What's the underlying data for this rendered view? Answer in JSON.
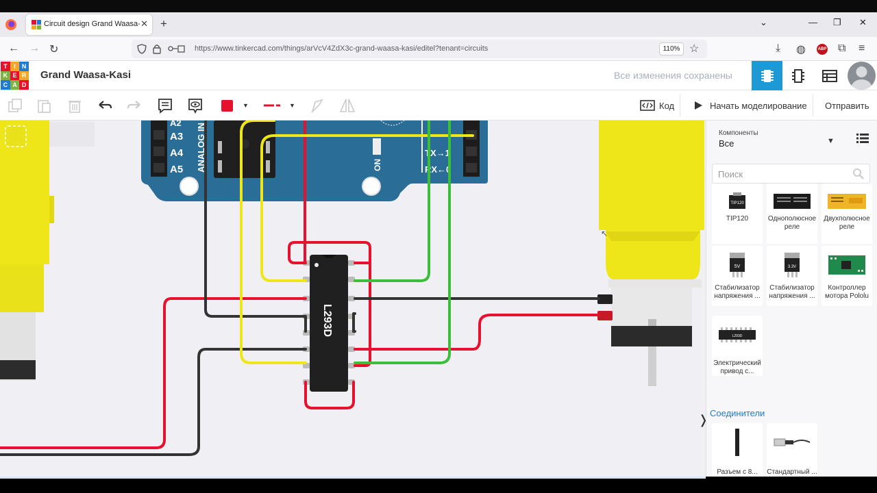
{
  "browser": {
    "tab_title": "Circuit design Grand Waasa-Kasi",
    "url": "https://www.tinkercad.com/things/arVcV4ZdX3c-grand-waasa-kasi/editel?tenant=circuits",
    "zoom": "110%"
  },
  "app": {
    "logo_letters": [
      "T",
      "I",
      "N",
      "K",
      "E",
      "R",
      "C",
      "A",
      "D"
    ],
    "project_title": "Grand Waasa-Kasi",
    "save_status": "Все изменения сохранены"
  },
  "toolbar": {
    "code_label": "Код",
    "simulate_label": "Начать моделирование",
    "send_label": "Отправить",
    "wire_color": "#e8112d"
  },
  "canvas": {
    "arduino_pins": [
      "A2",
      "A3",
      "A4",
      "A5"
    ],
    "analog_label": "ANALOG IN",
    "on_label": "ON",
    "tx_label": "TX→1",
    "rx_label": "RX←0",
    "chip_label": "L293D"
  },
  "sidebar": {
    "components_label": "Компоненты",
    "components_value": "Все",
    "search_placeholder": "Поиск",
    "cards": [
      {
        "label": "TIP120",
        "thumb_text": "TIP120"
      },
      {
        "label": "Однополюсное реле",
        "thumb_text": ""
      },
      {
        "label": "Двухполюсное реле",
        "thumb_text": ""
      },
      {
        "label": "Стабилизатор напряжения ...",
        "thumb_text": "5V"
      },
      {
        "label": "Стабилизатор напряжения ...",
        "thumb_text": "3.3V"
      },
      {
        "label": "Контроллер мотора Pololu",
        "thumb_text": ""
      },
      {
        "label": "Электрический привод с...",
        "thumb_text": "L293D"
      }
    ],
    "connectors_title": "Соединители",
    "connector_cards": [
      {
        "label": "Разъем с 8..."
      },
      {
        "label": "Стандартный ..."
      }
    ]
  }
}
